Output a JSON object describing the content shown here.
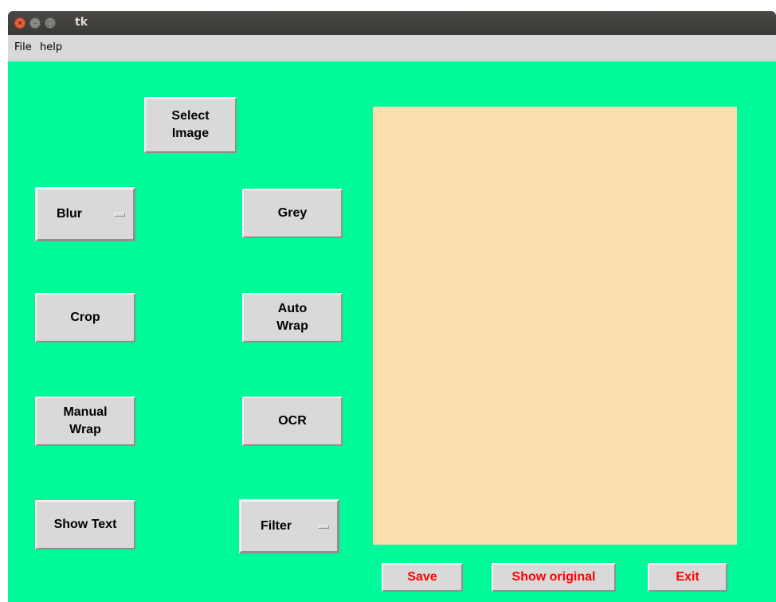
{
  "window": {
    "title": "tk"
  },
  "menu": {
    "file": "File",
    "help": "help"
  },
  "buttons": {
    "select_image": "Select\nImage",
    "blur": "Blur",
    "grey": "Grey",
    "crop": "Crop",
    "auto_wrap": "Auto\nWrap",
    "manual_wrap": "Manual\nWrap",
    "ocr": "OCR",
    "show_text": "Show Text",
    "filter": "Filter",
    "save": "Save",
    "show_original": "Show original",
    "exit": "Exit"
  },
  "colors": {
    "background": "#00fa9a",
    "image_panel": "#fddeae",
    "button_face": "#d9d9d9",
    "action_text": "#ff0000"
  }
}
